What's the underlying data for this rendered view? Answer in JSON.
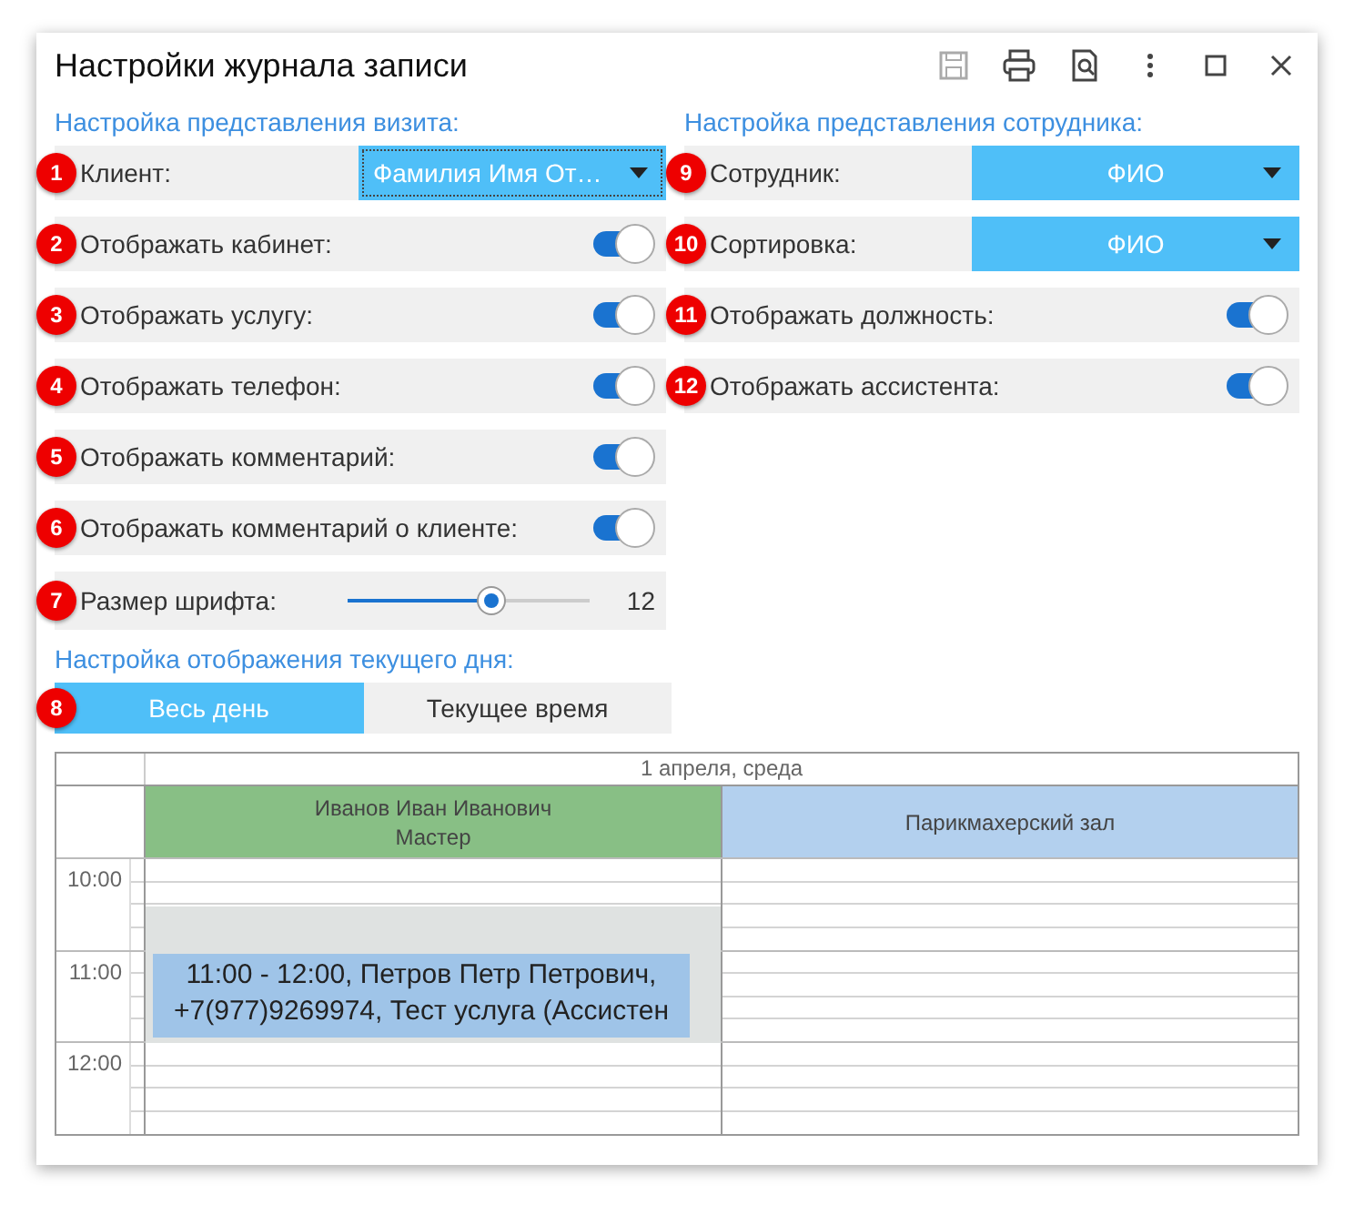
{
  "window": {
    "title": "Настройки журнала записи"
  },
  "visit_section": {
    "heading": "Настройка представления визита:",
    "rows": [
      {
        "kind": "dropdown",
        "badge": "1",
        "label": "Клиент:",
        "value": "Фамилия Имя От…",
        "focused": true
      },
      {
        "kind": "toggle",
        "badge": "2",
        "label": "Отображать кабинет:",
        "on": true
      },
      {
        "kind": "toggle",
        "badge": "3",
        "label": "Отображать услугу:",
        "on": true
      },
      {
        "kind": "toggle",
        "badge": "4",
        "label": "Отображать телефон:",
        "on": true
      },
      {
        "kind": "toggle",
        "badge": "5",
        "label": "Отображать комментарий:",
        "on": true
      },
      {
        "kind": "toggle",
        "badge": "6",
        "label": "Отображать комментарий о клиенте:",
        "on": true
      },
      {
        "kind": "slider",
        "badge": "7",
        "label": "Размер шрифта:",
        "level": 0.59,
        "reading": "12"
      }
    ]
  },
  "employee_section": {
    "heading": "Настройка представления сотрудника:",
    "rows": [
      {
        "kind": "dropdown",
        "badge": "9",
        "label": "Сотрудник:",
        "value": "ФИО",
        "focused": false
      },
      {
        "kind": "dropdown",
        "badge": "10",
        "label": "Сортировка:",
        "value": "ФИО",
        "focused": false
      },
      {
        "kind": "toggle",
        "badge": "11",
        "label": "Отображать должность:",
        "on": true
      },
      {
        "kind": "toggle",
        "badge": "12",
        "label": "Отображать ассистента:",
        "on": true
      }
    ]
  },
  "day_section": {
    "heading": "Настройка отображения текущего дня:",
    "badge": "8",
    "options": [
      {
        "label": "Весь день",
        "selected": true
      },
      {
        "label": "Текущее время",
        "selected": false
      }
    ]
  },
  "calendar": {
    "date": "1 апреля, среда",
    "hours": [
      "10:00",
      "11:00",
      "12:00"
    ],
    "columns": [
      {
        "title": "Иванов Иван Иванович",
        "subtitle": "Мастер",
        "color": "#88bf85",
        "events": [
          {
            "lines": [
              "11:00 - 12:00, Петров Петр Петрович,",
              "+7(977)9269974, Тест услуга (Ассистен"
            ]
          }
        ]
      },
      {
        "title": "Парикмахерский зал",
        "color": "#b3d0ee"
      }
    ]
  }
}
